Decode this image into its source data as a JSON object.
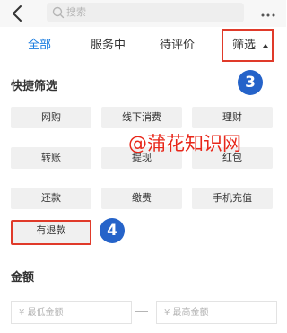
{
  "colors": {
    "accent": "#1b7de0",
    "highlight_border": "#e03a2a",
    "badge": "#2563c9",
    "watermark": "#e8271a",
    "chip_background": "#f0f0f0"
  },
  "nav": {
    "back_icon": "chevron-left-icon",
    "search_icon": "search-icon",
    "search_placeholder": "搜索",
    "more_icon": "more-dots-icon"
  },
  "tabs": [
    {
      "label": "全部",
      "active": true
    },
    {
      "label": "服务中",
      "active": false
    },
    {
      "label": "待评价",
      "active": false
    }
  ],
  "filter": {
    "label": "筛选",
    "caret_icon": "caret-up-icon"
  },
  "quick_filter": {
    "title": "快捷筛选",
    "step_badge": "3",
    "chips": [
      "网购",
      "线下消费",
      "理财",
      "转账",
      "提现",
      "红包",
      "还款",
      "缴费",
      "手机充值"
    ],
    "refund_chip": "有退款",
    "refund_step_badge": "4"
  },
  "watermark": "@蒲花知识网",
  "amount": {
    "title": "金额",
    "min_placeholder": "¥ 最低金额",
    "max_placeholder": "¥ 最高金额"
  }
}
